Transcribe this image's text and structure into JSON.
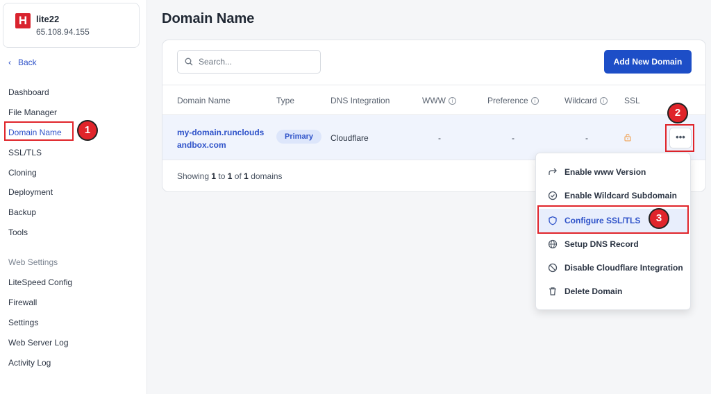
{
  "server": {
    "logo_letter": "H",
    "name": "lite22",
    "ip": "65.108.94.155"
  },
  "back_label": "Back",
  "nav": {
    "items": [
      "Dashboard",
      "File Manager",
      "Domain Name",
      "SSL/TLS",
      "Cloning",
      "Deployment",
      "Backup",
      "Tools"
    ],
    "section_label": "Web Settings",
    "settings_items": [
      "LiteSpeed Config",
      "Firewall",
      "Settings",
      "Web Server Log",
      "Activity Log"
    ]
  },
  "page_title": "Domain Name",
  "search": {
    "placeholder": "Search..."
  },
  "add_button": "Add New Domain",
  "table": {
    "headers": {
      "domain": "Domain Name",
      "type": "Type",
      "dns": "DNS Integration",
      "www": "WWW",
      "preference": "Preference",
      "wildcard": "Wildcard",
      "ssl": "SSL"
    },
    "row": {
      "domain": "my-domain.runcloudsandbox.com",
      "type": "Primary",
      "dns": "Cloudflare",
      "www": "-",
      "preference": "-",
      "wildcard": "-"
    }
  },
  "footer": {
    "prefix": "Showing",
    "from": "1",
    "to_word": "to",
    "to": "1",
    "of_word": "of",
    "total": "1",
    "suffix": "domains"
  },
  "menu": {
    "items": [
      "Enable www Version",
      "Enable Wildcard Subdomain",
      "Configure SSL/TLS",
      "Setup DNS Record",
      "Disable Cloudflare Integration",
      "Delete Domain"
    ]
  },
  "annotations": {
    "step1": "1",
    "step2": "2",
    "step3": "3"
  },
  "colors": {
    "accent": "#1d4ec7",
    "highlight": "#e0242a",
    "brand": "#d9232e"
  }
}
